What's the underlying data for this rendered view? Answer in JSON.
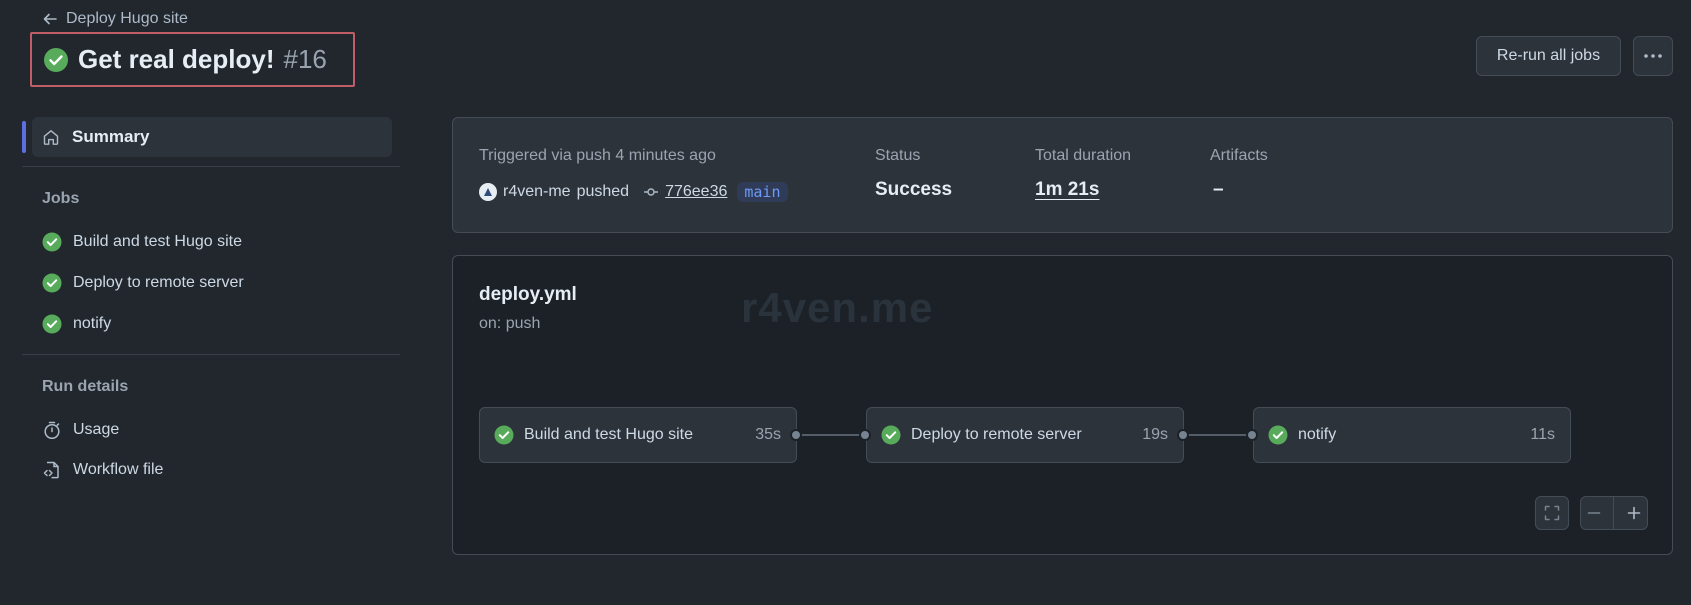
{
  "header": {
    "back_label": "Deploy Hugo site",
    "title": "Get real deploy!",
    "run_number": "#16",
    "rerun_label": "Re-run all jobs"
  },
  "sidebar": {
    "summary_label": "Summary",
    "jobs_heading": "Jobs",
    "jobs": [
      {
        "label": "Build and test Hugo site"
      },
      {
        "label": "Deploy to remote server"
      },
      {
        "label": "notify"
      }
    ],
    "run_details_heading": "Run details",
    "details": [
      {
        "label": "Usage",
        "icon": "stopwatch-icon"
      },
      {
        "label": "Workflow file",
        "icon": "file-code-icon"
      }
    ]
  },
  "summary": {
    "triggered_text": "Triggered via push 4 minutes ago",
    "actor": "r4ven-me",
    "pushed_word": "pushed",
    "commit": "776ee36",
    "branch": "main",
    "status_label": "Status",
    "status_value": "Success",
    "duration_label": "Total duration",
    "duration_value": "1m 21s",
    "artifacts_label": "Artifacts",
    "artifacts_value": "–"
  },
  "workflow": {
    "file": "deploy.yml",
    "trigger": "on: push",
    "watermark": "r4ven.me",
    "jobs": [
      {
        "name": "Build and test Hugo site",
        "time": "35s"
      },
      {
        "name": "Deploy to remote server",
        "time": "19s"
      },
      {
        "name": "notify",
        "time": "11s"
      }
    ]
  },
  "colors": {
    "success": "#57ab5a",
    "highlight_border": "#c05d67",
    "nav_marker": "#5b6fe0",
    "branch_text": "#6d9bf5"
  }
}
